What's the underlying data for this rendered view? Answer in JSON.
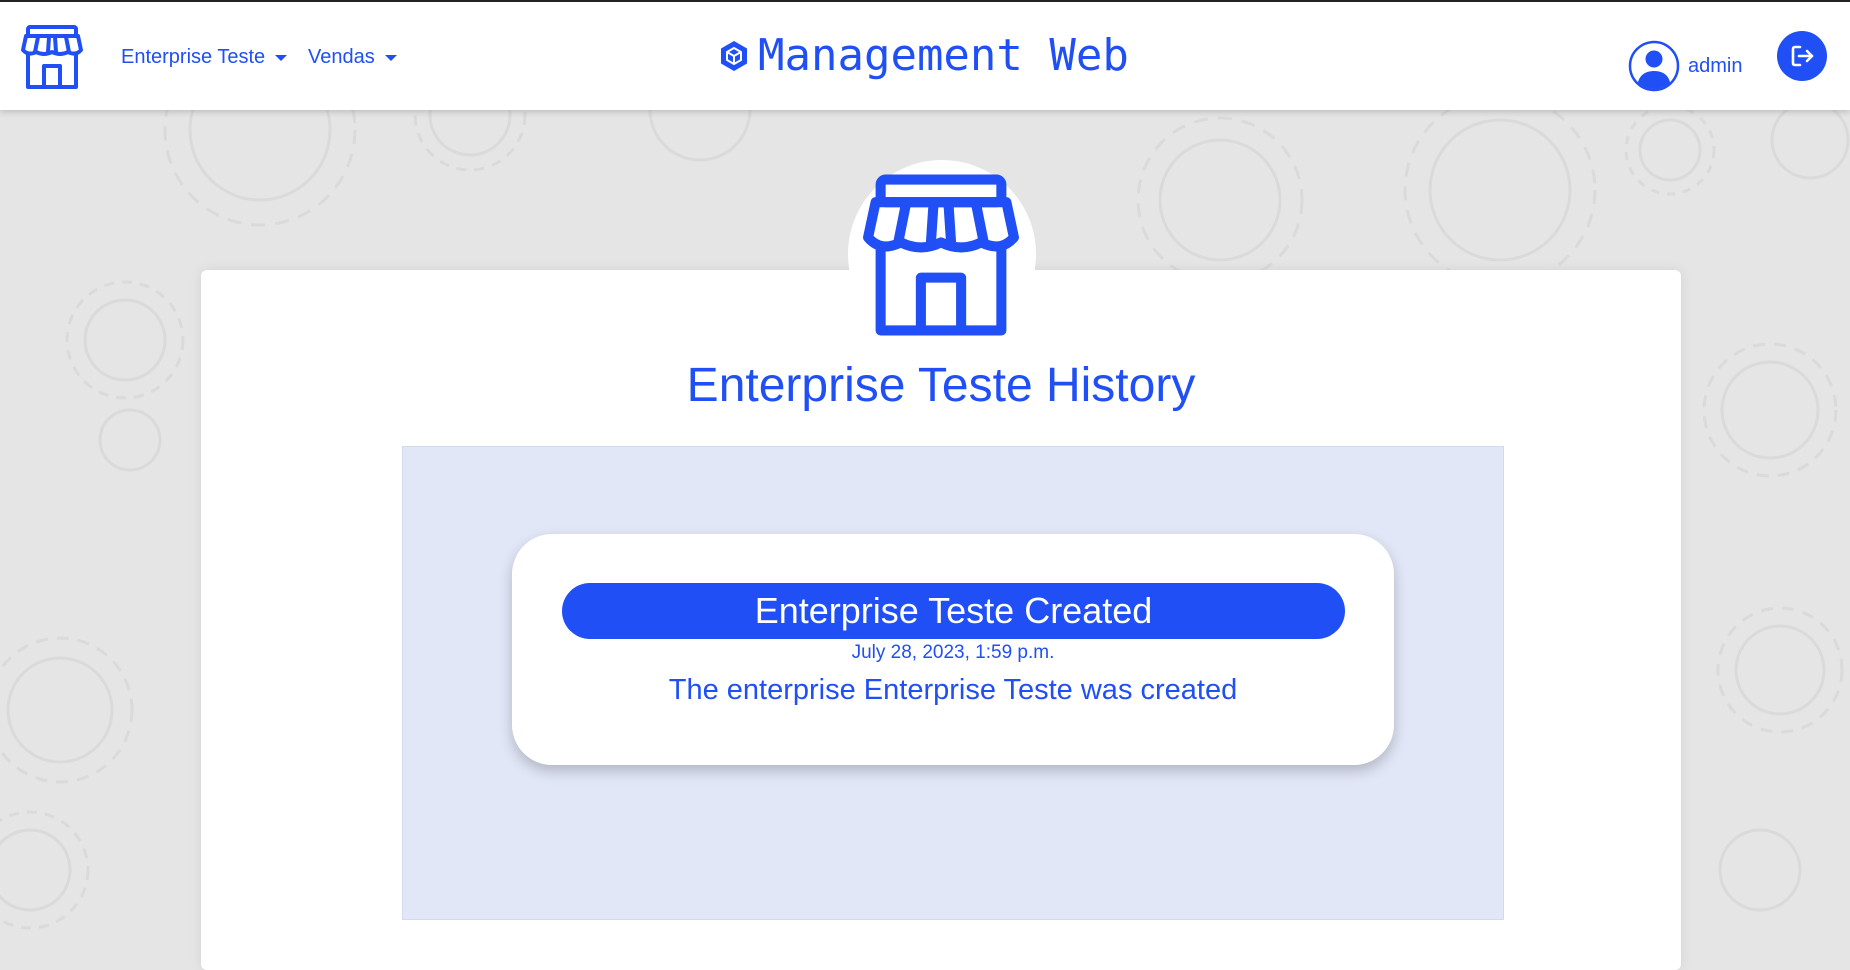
{
  "header": {
    "title": "Management Web",
    "nav": [
      {
        "label": "Enterprise Teste"
      },
      {
        "label": "Vendas"
      }
    ],
    "user": {
      "name": "admin"
    },
    "icons": {
      "brand": "store-icon",
      "title": "cube-icon",
      "avatar": "user-circle-icon",
      "logout": "logout-icon"
    }
  },
  "main": {
    "title": "Enterprise Teste History",
    "header_icon": "store-icon",
    "events": [
      {
        "title": "Enterprise Teste Created",
        "date": "July 28, 2023, 1:59 p.m.",
        "description": "The enterprise Enterprise Teste was created"
      }
    ]
  },
  "colors": {
    "accent": "#1f4ff5",
    "page_background": "#e5e5e5",
    "timeline_background": "#e2e7f8"
  }
}
